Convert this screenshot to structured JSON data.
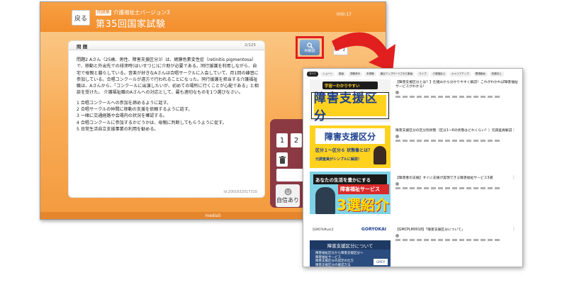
{
  "app": {
    "back_label": "戻る",
    "subject_badge": "問題集",
    "subject_title": "介護福祉士バージョン3",
    "exam_title": "第35回国家試験",
    "timer": "000:17",
    "question": {
      "header_label": "問 題",
      "counter": "2/125",
      "body": "問題2  Aさん（25歳、男性、障害支援区分3）は、網膜色素変性症（retinitis pigmentosa）で、移動と外出先での排泄時(はいせつじ)に介助が必要である。同行援護を利用しながら、自宅で母親と暮らしている。音楽が好きなAさんは合唱サークルに入会していて、月1回の練習に参加している。合唱コンクールが遠方で行われることになった。同行援護を担当する介護福祉職は、Aさんから、「コンクールに出演したいが、初めての場所に行くことが心配である」と相談を受けた。 介護福祉職のAさんへの対応として、最も適切なものを1つ選びなさい。",
      "choices": [
        "1 合唱コンクールへの参加を諦めるように話す。",
        "2 合唱サークルの仲間に移動の支援を依頼するように話す。",
        "3 一緒に交通経路や会場内の状況を確認する。",
        "4 合唱コンクールに参加するかどうかは、母親に判断してもらうように促す。",
        "5 日常生活自立支援事業の利用を勧める。"
      ],
      "question_id": "id:2001632017310"
    },
    "ai_button_label": "AI解説",
    "end_label": "終 了",
    "pad": {
      "key1": "1",
      "key2": "2",
      "self_confidence_label": "自信あり"
    },
    "footer": "media5"
  },
  "results": {
    "chips": [
      "すべて",
      "ショート",
      "動画",
      "視聴済み",
      "未視聴",
      "最近アップロードされた動画",
      "ライブ",
      "介護福祉士",
      "キャリアアップ",
      "関連動画",
      "知識向上"
    ],
    "thumb1": {
      "kicker": "宇宙一わかりやすい",
      "title": "障害支援区分"
    },
    "thumb2": {
      "title": "障害支援区分",
      "sub": "区分１～区分６ 状態像とは？",
      "sub2": "元調査員がシンプルに解説！"
    },
    "thumb3": {
      "top": "あなたの生活を豊かにする",
      "mid": "障害福祉サービス",
      "big": "3選紹介"
    },
    "thumb4": {
      "left": "【GMCPLMusic】",
      "right": "GORYOKAI"
    },
    "thumb5": {
      "head": "障害支援区分について",
      "lines": [
        "障害福祉区分から障害支援区分へ",
        "障害福祉サービス",
        "障害支援区分の認定の仕方",
        "障害支援区分の確認方法"
      ],
      "logo": "GMCP"
    },
    "items": [
      {
        "title": "【障害支援区分とは？】仕組みから分かりやすく解説！これがわかれば障害福祉サービスがわかる！"
      },
      {
        "title": "障害支援区分の区分別状態（区分1～6の状態はどれくらい？）元調査員解説"
      },
      {
        "title": "【障害者の支援】すぐに支援が実現できる障害福祉サービス3選"
      },
      {
        "title": "【GMCPLM0018】「障害支援区分について」"
      }
    ]
  }
}
